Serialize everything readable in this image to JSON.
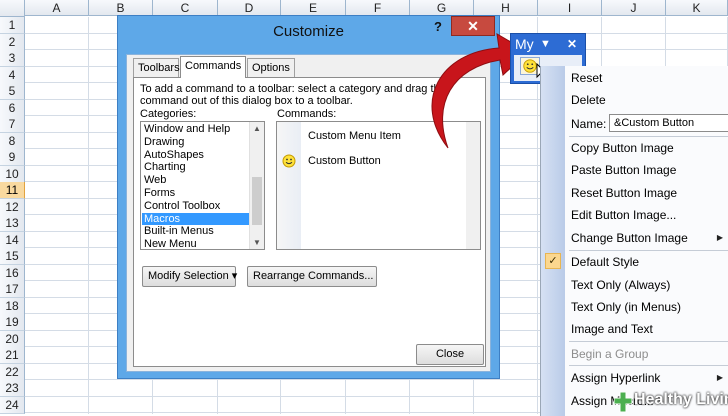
{
  "sheet": {
    "columns": [
      "A",
      "B",
      "C",
      "D",
      "E",
      "F",
      "G",
      "H",
      "I",
      "J",
      "K"
    ],
    "rows": [
      "1",
      "2",
      "3",
      "4",
      "5",
      "6",
      "7",
      "8",
      "9",
      "10",
      "11",
      "12",
      "13",
      "14",
      "15",
      "16",
      "17",
      "18",
      "19",
      "20",
      "21",
      "22",
      "23",
      "24"
    ],
    "selected_row": "11"
  },
  "dialog": {
    "title": "Customize",
    "help_label": "?",
    "close_x_label": "✕",
    "tabs": [
      {
        "label": "Toolbars",
        "active": false
      },
      {
        "label": "Commands",
        "active": true
      },
      {
        "label": "Options",
        "active": false
      }
    ],
    "instruction": "To add a command to a toolbar: select a category and drag the command out of this dialog box to a toolbar.",
    "categories_label": "Categories:",
    "commands_label": "Commands:",
    "categories": [
      "Window and Help",
      "Drawing",
      "AutoShapes",
      "Charting",
      "Web",
      "Forms",
      "Control Toolbox",
      "Macros",
      "Built-in Menus",
      "New Menu"
    ],
    "selected_category": "Macros",
    "commands": [
      {
        "label": "Custom Menu Item",
        "icon": "blank-icon"
      },
      {
        "label": "Custom Button",
        "icon": "smiley-icon"
      }
    ],
    "modify_selection_label": "Modify Selection ▾",
    "rearrange_label": "Rearrange Commands...",
    "close_label": "Close"
  },
  "toolbar": {
    "title": "My",
    "dropdown_glyph": "▼",
    "close_glyph": "✕"
  },
  "menu": {
    "name_label": "Name:",
    "name_value": "&Custom Button",
    "items": [
      {
        "label": "Reset",
        "submenu": false,
        "disabled": false
      },
      {
        "label": "Delete",
        "submenu": false,
        "disabled": false
      },
      {
        "label": "Copy Button Image",
        "submenu": false,
        "disabled": false
      },
      {
        "label": "Paste Button Image",
        "submenu": false,
        "disabled": false
      },
      {
        "label": "Reset Button Image",
        "submenu": false,
        "disabled": false
      },
      {
        "label": "Edit Button Image...",
        "submenu": false,
        "disabled": false
      },
      {
        "label": "Change Button Image",
        "submenu": true,
        "disabled": false
      },
      {
        "label": "Default Style",
        "submenu": false,
        "disabled": false,
        "checked": true
      },
      {
        "label": "Text Only (Always)",
        "submenu": false,
        "disabled": false
      },
      {
        "label": "Text Only (in Menus)",
        "submenu": false,
        "disabled": false
      },
      {
        "label": "Image and Text",
        "submenu": false,
        "disabled": false
      },
      {
        "label": "Begin a Group",
        "submenu": false,
        "disabled": true
      },
      {
        "label": "Assign Hyperlink",
        "submenu": true,
        "disabled": false
      },
      {
        "label": "Assign Macro...",
        "submenu": false,
        "disabled": false
      }
    ]
  },
  "watermark": {
    "text": "Healthy Living"
  },
  "colors": {
    "arrow": "#c8151b",
    "dialog_frame": "#5ea8e8",
    "toolbar": "#2d6cd4",
    "selection": "#3399ff",
    "check_highlight": "#fbd78f"
  }
}
